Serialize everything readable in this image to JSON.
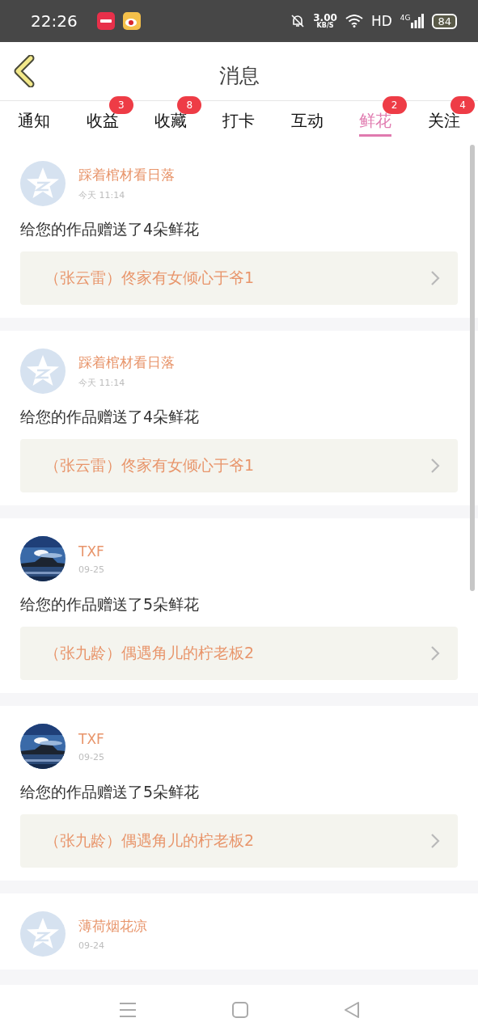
{
  "status_bar": {
    "time": "22:26",
    "speed": "3.00",
    "speed_unit": "KB/S",
    "network": "HD",
    "cell": "4G",
    "battery": "84"
  },
  "header": {
    "title": "消息"
  },
  "tabs": [
    {
      "label": "通知",
      "selected": false
    },
    {
      "label": "收益",
      "selected": false,
      "badge": "3"
    },
    {
      "label": "收藏",
      "selected": false,
      "badge": "8"
    },
    {
      "label": "打卡",
      "selected": false
    },
    {
      "label": "互动",
      "selected": false
    },
    {
      "label": "鲜花",
      "selected": true,
      "badge": "2"
    },
    {
      "label": "关注",
      "selected": false,
      "badge": "4"
    }
  ],
  "messages": [
    {
      "avatar": {
        "kind": "default"
      },
      "name": "踩着棺材看日落",
      "time": "今天 11:14",
      "text": "给您的作品赠送了4朵鲜花",
      "work": "（张云雷）佟家有女倾心于爷1"
    },
    {
      "avatar": {
        "kind": "default"
      },
      "name": "踩着棺材看日落",
      "time": "今天 11:14",
      "text": "给您的作品赠送了4朵鲜花",
      "work": "（张云雷）佟家有女倾心于爷1"
    },
    {
      "name": "TXF",
      "time": "09-25",
      "text": "给您的作品赠送了5朵鲜花",
      "work": "（张九龄）偶遇角儿的柠老板2"
    },
    {
      "name": "TXF",
      "time": "09-25",
      "text": "给您的作品赠送了5朵鲜花",
      "work": "（张九龄）偶遇角儿的柠老板2"
    },
    {
      "avatar": {
        "kind": "default"
      },
      "name": "薄荷烟花凉",
      "time": "09-24"
    }
  ]
}
